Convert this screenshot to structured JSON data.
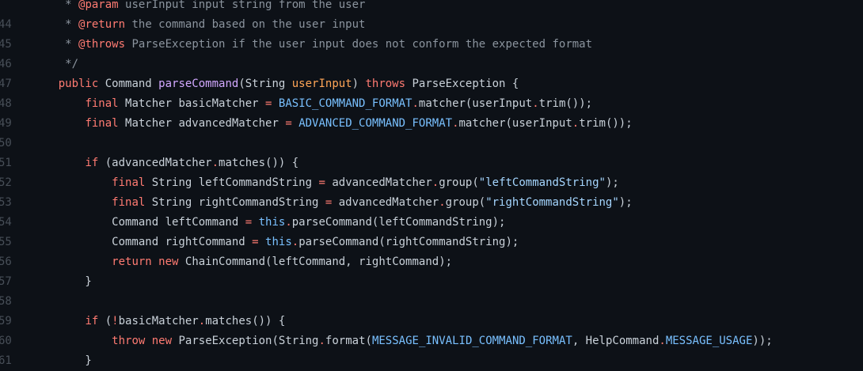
{
  "editor": {
    "lines": [
      {
        "num": "",
        "tokens": [
          {
            "t": "    ",
            "c": "plain"
          },
          {
            "t": " * ",
            "c": "comment"
          },
          {
            "t": "@param",
            "c": "tag"
          },
          {
            "t": " userInput input string from the user",
            "c": "comment"
          }
        ]
      },
      {
        "num": "44",
        "tokens": [
          {
            "t": "     * ",
            "c": "comment"
          },
          {
            "t": "@return",
            "c": "tag"
          },
          {
            "t": " the command based on the user input",
            "c": "comment"
          }
        ]
      },
      {
        "num": "45",
        "tokens": [
          {
            "t": "     * ",
            "c": "comment"
          },
          {
            "t": "@throws",
            "c": "tag"
          },
          {
            "t": " ParseException if the user input does not conform the expected format",
            "c": "comment"
          }
        ]
      },
      {
        "num": "46",
        "tokens": [
          {
            "t": "     */",
            "c": "comment"
          }
        ]
      },
      {
        "num": "47",
        "tokens": [
          {
            "t": "    ",
            "c": "plain"
          },
          {
            "t": "public",
            "c": "kw"
          },
          {
            "t": " Command ",
            "c": "plain"
          },
          {
            "t": "parseCommand",
            "c": "func"
          },
          {
            "t": "(String ",
            "c": "plain"
          },
          {
            "t": "userInput",
            "c": "param"
          },
          {
            "t": ") ",
            "c": "plain"
          },
          {
            "t": "throws",
            "c": "kw"
          },
          {
            "t": " ParseException {",
            "c": "plain"
          }
        ]
      },
      {
        "num": "48",
        "tokens": [
          {
            "t": "        ",
            "c": "plain"
          },
          {
            "t": "final",
            "c": "kw"
          },
          {
            "t": " Matcher basicMatcher ",
            "c": "plain"
          },
          {
            "t": "=",
            "c": "op"
          },
          {
            "t": " ",
            "c": "plain"
          },
          {
            "t": "BASIC_COMMAND_FORMAT",
            "c": "const"
          },
          {
            "t": ".",
            "c": "dot"
          },
          {
            "t": "matcher(userInput",
            "c": "plain"
          },
          {
            "t": ".",
            "c": "dot"
          },
          {
            "t": "trim());",
            "c": "plain"
          }
        ]
      },
      {
        "num": "49",
        "tokens": [
          {
            "t": "        ",
            "c": "plain"
          },
          {
            "t": "final",
            "c": "kw"
          },
          {
            "t": " Matcher advancedMatcher ",
            "c": "plain"
          },
          {
            "t": "=",
            "c": "op"
          },
          {
            "t": " ",
            "c": "plain"
          },
          {
            "t": "ADVANCED_COMMAND_FORMAT",
            "c": "const"
          },
          {
            "t": ".",
            "c": "dot"
          },
          {
            "t": "matcher(userInput",
            "c": "plain"
          },
          {
            "t": ".",
            "c": "dot"
          },
          {
            "t": "trim());",
            "c": "plain"
          }
        ]
      },
      {
        "num": "50",
        "tokens": []
      },
      {
        "num": "51",
        "tokens": [
          {
            "t": "        ",
            "c": "plain"
          },
          {
            "t": "if",
            "c": "kw"
          },
          {
            "t": " (advancedMatcher",
            "c": "plain"
          },
          {
            "t": ".",
            "c": "dot"
          },
          {
            "t": "matches()) {",
            "c": "plain"
          }
        ]
      },
      {
        "num": "52",
        "tokens": [
          {
            "t": "            ",
            "c": "plain"
          },
          {
            "t": "final",
            "c": "kw"
          },
          {
            "t": " String leftCommandString ",
            "c": "plain"
          },
          {
            "t": "=",
            "c": "op"
          },
          {
            "t": " advancedMatcher",
            "c": "plain"
          },
          {
            "t": ".",
            "c": "dot"
          },
          {
            "t": "group(",
            "c": "plain"
          },
          {
            "t": "\"leftCommandString\"",
            "c": "str"
          },
          {
            "t": ");",
            "c": "plain"
          }
        ]
      },
      {
        "num": "53",
        "tokens": [
          {
            "t": "            ",
            "c": "plain"
          },
          {
            "t": "final",
            "c": "kw"
          },
          {
            "t": " String rightCommandString ",
            "c": "plain"
          },
          {
            "t": "=",
            "c": "op"
          },
          {
            "t": " advancedMatcher",
            "c": "plain"
          },
          {
            "t": ".",
            "c": "dot"
          },
          {
            "t": "group(",
            "c": "plain"
          },
          {
            "t": "\"rightCommandString\"",
            "c": "str"
          },
          {
            "t": ");",
            "c": "plain"
          }
        ]
      },
      {
        "num": "54",
        "tokens": [
          {
            "t": "            Command leftCommand ",
            "c": "plain"
          },
          {
            "t": "=",
            "c": "op"
          },
          {
            "t": " ",
            "c": "plain"
          },
          {
            "t": "this",
            "c": "const"
          },
          {
            "t": ".",
            "c": "dot"
          },
          {
            "t": "parseCommand(leftCommandString);",
            "c": "plain"
          }
        ]
      },
      {
        "num": "55",
        "tokens": [
          {
            "t": "            Command rightCommand ",
            "c": "plain"
          },
          {
            "t": "=",
            "c": "op"
          },
          {
            "t": " ",
            "c": "plain"
          },
          {
            "t": "this",
            "c": "const"
          },
          {
            "t": ".",
            "c": "dot"
          },
          {
            "t": "parseCommand(rightCommandString);",
            "c": "plain"
          }
        ]
      },
      {
        "num": "56",
        "tokens": [
          {
            "t": "            ",
            "c": "plain"
          },
          {
            "t": "return",
            "c": "kw"
          },
          {
            "t": " ",
            "c": "plain"
          },
          {
            "t": "new",
            "c": "kw"
          },
          {
            "t": " ChainCommand(leftCommand, rightCommand);",
            "c": "plain"
          }
        ]
      },
      {
        "num": "57",
        "tokens": [
          {
            "t": "        }",
            "c": "plain"
          }
        ]
      },
      {
        "num": "58",
        "tokens": []
      },
      {
        "num": "59",
        "tokens": [
          {
            "t": "        ",
            "c": "plain"
          },
          {
            "t": "if",
            "c": "kw"
          },
          {
            "t": " (",
            "c": "plain"
          },
          {
            "t": "!",
            "c": "op"
          },
          {
            "t": "basicMatcher",
            "c": "plain"
          },
          {
            "t": ".",
            "c": "dot"
          },
          {
            "t": "matches()) {",
            "c": "plain"
          }
        ]
      },
      {
        "num": "60",
        "tokens": [
          {
            "t": "            ",
            "c": "plain"
          },
          {
            "t": "throw",
            "c": "kw"
          },
          {
            "t": " ",
            "c": "plain"
          },
          {
            "t": "new",
            "c": "kw"
          },
          {
            "t": " ParseException(String",
            "c": "plain"
          },
          {
            "t": ".",
            "c": "dot"
          },
          {
            "t": "format(",
            "c": "plain"
          },
          {
            "t": "MESSAGE_INVALID_COMMAND_FORMAT",
            "c": "const"
          },
          {
            "t": ", HelpCommand",
            "c": "plain"
          },
          {
            "t": ".",
            "c": "dot"
          },
          {
            "t": "MESSAGE_USAGE",
            "c": "const"
          },
          {
            "t": "));",
            "c": "plain"
          }
        ]
      },
      {
        "num": "61",
        "tokens": [
          {
            "t": "        }",
            "c": "plain"
          }
        ]
      }
    ]
  }
}
